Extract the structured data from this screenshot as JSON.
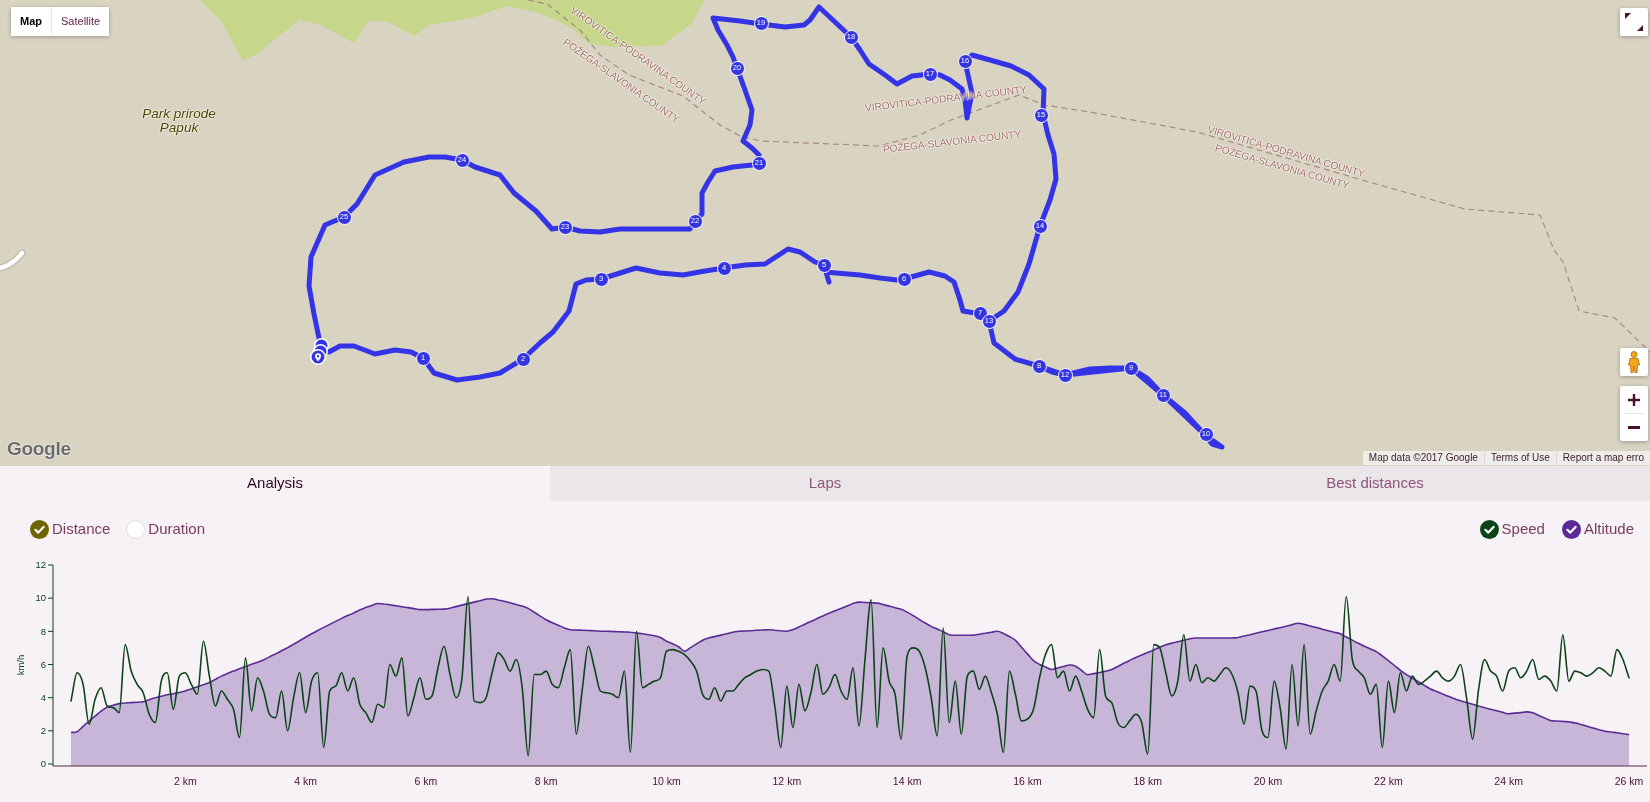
{
  "map": {
    "map_types": [
      {
        "label": "Map",
        "selected": true
      },
      {
        "label": "Satellite",
        "selected": false
      }
    ],
    "labels": [
      {
        "kind": "boundary",
        "text": "VIROVITICA-PODRAVINA COUNTY"
      },
      {
        "kind": "boundary",
        "text": "POŽEGA-SLAVONIA COUNTY"
      },
      {
        "kind": "park",
        "text": "Park prirode Papuk"
      },
      {
        "kind": "boundary",
        "text": "VIROVITICA-PODRAVINA COUNTY"
      },
      {
        "kind": "boundary",
        "text": "POŽEGA-SLAVONIA COUNTY"
      },
      {
        "kind": "boundary",
        "text": "VIROVITICA-PODRAVINA COUNTY"
      },
      {
        "kind": "boundary",
        "text": "POŽEGA-SLAVONIA COUNTY"
      }
    ],
    "markers": [
      "19",
      "18",
      "20",
      "17",
      "16",
      "15",
      "24",
      "21",
      "25",
      "23",
      "22",
      "14",
      "3",
      "4",
      "5",
      "6",
      "7",
      "13",
      "1",
      "2",
      "8",
      "12",
      "9",
      "11",
      "10"
    ],
    "logo": "Google",
    "attribution": [
      "Map data ©2017 Google",
      "Terms of Use",
      "Report a map erro"
    ]
  },
  "tabs": [
    {
      "label": "Analysis",
      "selected": true
    },
    {
      "label": "Laps",
      "selected": false
    },
    {
      "label": "Best distances",
      "selected": false
    }
  ],
  "x_axis_options": [
    {
      "label": "Distance",
      "selected": true
    },
    {
      "label": "Duration",
      "selected": false
    }
  ],
  "series_toggles": [
    {
      "checked": true
    },
    {
      "checked": true
    }
  ],
  "altitude_chart": {
    "chart_data": {
      "type": "area",
      "xlim": [
        -0.2,
        26.3
      ],
      "ylim": [
        0,
        12
      ],
      "x": [
        0.1,
        0.2,
        0.3,
        0.4,
        0.5,
        0.6,
        0.7,
        0.8,
        0.9,
        1,
        1.1,
        1.2,
        1.3,
        1.4,
        1.5,
        1.6,
        1.7,
        1.8,
        1.9,
        2,
        2.1,
        2.2,
        2.3,
        2.4,
        2.5,
        2.6,
        2.7,
        2.8,
        2.9,
        3,
        3.1,
        3.2,
        3.3,
        3.4,
        3.5,
        3.6,
        3.7,
        3.8,
        3.9,
        4,
        4.1,
        4.2,
        4.3,
        4.4,
        4.5,
        4.6,
        4.7,
        4.8,
        4.9,
        5,
        5.1,
        5.2,
        5.3,
        5.4,
        5.5,
        5.6,
        5.7,
        5.8,
        5.9,
        6,
        6.1,
        6.2,
        6.3,
        6.4,
        6.5,
        6.6,
        6.7,
        6.8,
        6.9,
        7,
        7.1,
        7.2,
        7.3,
        7.4,
        7.5,
        7.6,
        7.7,
        7.8,
        7.9,
        8,
        8.1,
        8.2,
        8.3,
        8.4,
        8.5,
        8.6,
        8.7,
        8.8,
        8.9,
        9,
        9.1,
        9.2,
        9.3,
        9.4,
        9.5,
        9.6,
        9.7,
        9.8,
        9.9,
        10,
        10.1,
        10.2,
        10.3,
        10.4,
        10.5,
        10.6,
        10.7,
        10.8,
        10.9,
        11,
        11.1,
        11.2,
        11.3,
        11.4,
        11.5,
        11.6,
        11.7,
        11.8,
        11.9,
        12,
        12.1,
        12.2,
        12.3,
        12.4,
        12.5,
        12.6,
        12.7,
        12.8,
        12.9,
        13,
        13.1,
        13.2,
        13.3,
        13.4,
        13.5,
        13.6,
        13.7,
        13.8,
        13.9,
        14,
        14.1,
        14.2,
        14.3,
        14.4,
        14.5,
        14.6,
        14.7,
        14.8,
        14.9,
        15,
        15.1,
        15.2,
        15.3,
        15.4,
        15.5,
        15.6,
        15.7,
        15.8,
        15.9,
        16,
        16.1,
        16.2,
        16.3,
        16.4,
        16.5,
        16.6,
        16.7,
        16.8,
        16.9,
        17,
        17.1,
        17.2,
        17.3,
        17.4,
        17.5,
        17.6,
        17.7,
        17.8,
        17.9,
        18,
        18.1,
        18.2,
        18.3,
        18.4,
        18.5,
        18.6,
        18.7,
        18.8,
        18.9,
        19,
        19.1,
        19.2,
        19.3,
        19.4,
        19.5,
        19.6,
        19.7,
        19.8,
        19.9,
        20,
        20.1,
        20.2,
        20.3,
        20.4,
        20.5,
        20.6,
        20.7,
        20.8,
        20.9,
        21,
        21.1,
        21.2,
        21.3,
        21.4,
        21.5,
        21.6,
        21.7,
        21.8,
        21.9,
        22,
        22.1,
        22.2,
        22.3,
        22.4,
        22.5,
        22.6,
        22.7,
        22.8,
        22.9,
        23,
        23.1,
        23.2,
        23.3,
        23.4,
        23.5,
        23.6,
        23.7,
        23.8,
        23.9,
        24,
        24.1,
        24.2,
        24.3,
        24.4,
        24.5,
        24.6,
        24.7,
        24.8,
        24.9,
        25,
        25.1,
        25.2,
        25.3,
        25.4,
        25.5,
        25.6,
        25.7,
        25.8,
        25.9,
        26
      ],
      "series": [
        {
          "name": "Altitude",
          "color": "#5b2a96",
          "values": [
            1.9,
            1.95,
            2.27,
            2.58,
            2.88,
            3.19,
            3.43,
            3.54,
            3.64,
            3.68,
            3.7,
            3.72,
            3.75,
            3.88,
            4.0,
            4.09,
            4.17,
            4.24,
            4.31,
            4.4,
            4.53,
            4.66,
            4.78,
            4.91,
            5.1,
            5.3,
            5.45,
            5.6,
            5.74,
            5.88,
            6.01,
            6.14,
            6.27,
            6.46,
            6.64,
            6.83,
            7.01,
            7.22,
            7.43,
            7.64,
            7.85,
            8.05,
            8.24,
            8.42,
            8.6,
            8.78,
            8.95,
            9.11,
            9.28,
            9.43,
            9.55,
            9.68,
            9.65,
            9.6,
            9.54,
            9.48,
            9.43,
            9.37,
            9.31,
            9.31,
            9.32,
            9.33,
            9.34,
            9.39,
            9.49,
            9.58,
            9.67,
            9.76,
            9.85,
            9.95,
            9.97,
            9.89,
            9.81,
            9.72,
            9.62,
            9.52,
            9.38,
            9.15,
            8.92,
            8.7,
            8.52,
            8.37,
            8.21,
            8.1,
            8.08,
            8.07,
            8.05,
            8.03,
            8.01,
            8.0,
            7.99,
            7.98,
            7.96,
            7.95,
            7.9,
            7.85,
            7.79,
            7.73,
            7.62,
            7.4,
            7.25,
            7.07,
            6.8,
            7.02,
            7.24,
            7.46,
            7.6,
            7.68,
            7.77,
            7.85,
            7.94,
            8.0,
            8.02,
            8.04,
            8.06,
            8.08,
            8.1,
            8.07,
            8.04,
            8.01,
            8.1,
            8.26,
            8.43,
            8.6,
            8.76,
            8.93,
            9.09,
            9.24,
            9.38,
            9.53,
            9.67,
            9.76,
            9.74,
            9.72,
            9.7,
            9.61,
            9.52,
            9.42,
            9.33,
            9.16,
            8.94,
            8.72,
            8.5,
            8.3,
            8.14,
            7.97,
            7.8,
            7.76,
            7.76,
            7.76,
            7.77,
            7.83,
            7.89,
            7.95,
            8.01,
            7.87,
            7.69,
            7.46,
            7.05,
            6.64,
            6.23,
            6.0,
            5.85,
            5.7,
            5.79,
            5.88,
            5.97,
            5.89,
            5.64,
            5.38,
            5.45,
            5.52,
            5.59,
            5.7,
            5.88,
            6.07,
            6.25,
            6.43,
            6.58,
            6.73,
            6.88,
            7.04,
            7.19,
            7.29,
            7.37,
            7.46,
            7.55,
            7.6,
            7.6,
            7.6,
            7.6,
            7.6,
            7.6,
            7.6,
            7.63,
            7.72,
            7.8,
            7.88,
            7.97,
            8.05,
            8.14,
            8.22,
            8.31,
            8.4,
            8.49,
            8.42,
            8.32,
            8.23,
            8.13,
            8.04,
            7.95,
            7.86,
            7.66,
            7.47,
            7.28,
            7.1,
            6.94,
            6.78,
            6.52,
            6.23,
            5.94,
            5.65,
            5.39,
            5.17,
            4.96,
            4.74,
            4.52,
            4.37,
            4.22,
            4.08,
            3.93,
            3.81,
            3.71,
            3.6,
            3.49,
            3.39,
            3.3,
            3.21,
            3.12,
            3.03,
            3.07,
            3.1,
            3.14,
            3.09,
            2.93,
            2.78,
            2.62,
            2.59,
            2.57,
            2.54,
            2.48,
            2.38,
            2.28,
            2.17,
            2.07,
            1.98,
            1.93,
            1.88,
            1.82,
            1.77
          ]
        }
      ]
    }
  },
  "speed_chart": {
    "chart_data": {
      "type": "line",
      "ylabel": "km/h",
      "xlim": [
        -0.2,
        26.3
      ],
      "ylim": [
        0,
        12
      ],
      "yticks": [
        0,
        2,
        4,
        6,
        8,
        10,
        12
      ],
      "xticks": [
        {
          "value": 2,
          "label": "2 km"
        },
        {
          "value": 4,
          "label": "4 km"
        },
        {
          "value": 6,
          "label": "6 km"
        },
        {
          "value": 8,
          "label": "8 km"
        },
        {
          "value": 10,
          "label": "10 km"
        },
        {
          "value": 12,
          "label": "12 km"
        },
        {
          "value": 14,
          "label": "14 km"
        },
        {
          "value": 16,
          "label": "16 km"
        },
        {
          "value": 18,
          "label": "18 km"
        },
        {
          "value": 20,
          "label": "20 km"
        },
        {
          "value": 22,
          "label": "22 km"
        },
        {
          "value": 24,
          "label": "24 km"
        },
        {
          "value": 26,
          "label": "26 km"
        }
      ],
      "x": [
        0.1,
        0.2,
        0.3,
        0.4,
        0.5,
        0.6,
        0.7,
        0.8,
        0.9,
        1,
        1.1,
        1.2,
        1.3,
        1.4,
        1.5,
        1.6,
        1.7,
        1.8,
        1.9,
        2,
        2.1,
        2.2,
        2.3,
        2.4,
        2.5,
        2.6,
        2.7,
        2.8,
        2.9,
        3,
        3.1,
        3.2,
        3.3,
        3.4,
        3.5,
        3.6,
        3.7,
        3.8,
        3.9,
        4,
        4.1,
        4.2,
        4.3,
        4.4,
        4.5,
        4.6,
        4.7,
        4.8,
        4.9,
        5,
        5.1,
        5.2,
        5.3,
        5.4,
        5.5,
        5.6,
        5.7,
        5.8,
        5.9,
        6,
        6.1,
        6.2,
        6.3,
        6.4,
        6.5,
        6.6,
        6.7,
        6.8,
        6.9,
        7,
        7.1,
        7.2,
        7.3,
        7.4,
        7.5,
        7.6,
        7.7,
        7.8,
        7.9,
        8,
        8.1,
        8.2,
        8.3,
        8.4,
        8.5,
        8.6,
        8.7,
        8.8,
        8.9,
        9,
        9.1,
        9.2,
        9.3,
        9.4,
        9.5,
        9.6,
        9.7,
        9.8,
        9.9,
        10,
        10.1,
        10.2,
        10.3,
        10.4,
        10.5,
        10.6,
        10.7,
        10.8,
        10.9,
        11,
        11.1,
        11.2,
        11.3,
        11.4,
        11.5,
        11.6,
        11.7,
        11.8,
        11.9,
        12,
        12.1,
        12.2,
        12.3,
        12.4,
        12.5,
        12.6,
        12.7,
        12.8,
        12.9,
        13,
        13.1,
        13.2,
        13.3,
        13.4,
        13.5,
        13.6,
        13.7,
        13.8,
        13.9,
        14,
        14.1,
        14.2,
        14.3,
        14.4,
        14.5,
        14.6,
        14.7,
        14.8,
        14.9,
        15,
        15.1,
        15.2,
        15.3,
        15.4,
        15.5,
        15.6,
        15.7,
        15.8,
        15.9,
        16,
        16.1,
        16.2,
        16.3,
        16.4,
        16.5,
        16.6,
        16.7,
        16.8,
        16.9,
        17,
        17.1,
        17.2,
        17.3,
        17.4,
        17.5,
        17.6,
        17.7,
        17.8,
        17.9,
        18,
        18.1,
        18.2,
        18.3,
        18.4,
        18.5,
        18.6,
        18.7,
        18.8,
        18.9,
        19,
        19.1,
        19.2,
        19.3,
        19.4,
        19.5,
        19.6,
        19.7,
        19.8,
        19.9,
        20,
        20.1,
        20.2,
        20.3,
        20.4,
        20.5,
        20.6,
        20.7,
        20.8,
        20.9,
        21,
        21.1,
        21.2,
        21.3,
        21.4,
        21.5,
        21.6,
        21.7,
        21.8,
        21.9,
        22,
        22.1,
        22.2,
        22.3,
        22.4,
        22.5,
        22.6,
        22.7,
        22.8,
        22.9,
        23,
        23.1,
        23.2,
        23.3,
        23.4,
        23.5,
        23.6,
        23.7,
        23.8,
        23.9,
        24,
        24.1,
        24.2,
        24.3,
        24.4,
        24.5,
        24.6,
        24.7,
        24.8,
        24.9,
        25,
        25.1,
        25.2,
        25.3,
        25.4,
        25.5,
        25.6,
        25.7,
        25.8,
        25.9,
        26
      ],
      "series": [
        {
          "name": "Speed",
          "color": "#0d4318",
          "values": [
            3.8,
            5.5,
            4.8,
            2.4,
            3.9,
            4.6,
            3.5,
            3.4,
            3.1,
            7.2,
            5.6,
            4.8,
            4.3,
            3.0,
            2.5,
            5.0,
            5.5,
            3.3,
            5.3,
            5.5,
            4.8,
            4.2,
            7.4,
            5.3,
            3.5,
            4.4,
            3.9,
            3.3,
            1.6,
            6.4,
            3.2,
            5.2,
            4.4,
            3.0,
            2.8,
            4.4,
            2.0,
            4.0,
            5.5,
            3.1,
            5.0,
            5.5,
            1.0,
            4.4,
            4.7,
            5.5,
            4.4,
            5.2,
            3.6,
            3.1,
            2.5,
            3.6,
            3.4,
            6.0,
            5.3,
            6.4,
            2.9,
            4.0,
            5.2,
            3.9,
            4.1,
            5.8,
            7.1,
            5.4,
            4.0,
            5.2,
            10.1,
            3.8,
            3.7,
            4.0,
            5.5,
            6.7,
            6.3,
            5.6,
            6.3,
            4.6,
            0.5,
            5.4,
            5.4,
            5.6,
            4.8,
            4.6,
            5.8,
            6.9,
            1.8,
            4.5,
            7.1,
            5.8,
            4.4,
            4.3,
            4.2,
            4.0,
            5.6,
            0.7,
            8.0,
            4.6,
            4.8,
            5.0,
            5.2,
            6.8,
            6.9,
            6.8,
            6.6,
            6.2,
            5.6,
            4.2,
            3.9,
            4.6,
            3.8,
            4.4,
            4.4,
            4.8,
            5.2,
            5.4,
            5.6,
            5.7,
            5.6,
            3.5,
            1.0,
            4.7,
            2.2,
            4.8,
            3.2,
            4.3,
            6.0,
            4.2,
            4.6,
            5.4,
            4.4,
            3.9,
            5.8,
            2.3,
            6.3,
            9.9,
            2.2,
            7.0,
            5.0,
            4.2,
            1.5,
            6.5,
            7.0,
            6.8,
            5.8,
            4.0,
            1.7,
            8.2,
            2.5,
            5.0,
            1.8,
            5.3,
            5.6,
            4.5,
            5.3,
            4.3,
            3.0,
            0.7,
            5.6,
            4.2,
            2.6,
            2.7,
            3.3,
            5.2,
            6.6,
            7.2,
            5.2,
            5.6,
            4.4,
            5.3,
            4.4,
            3.3,
            2.8,
            6.9,
            4.1,
            3.7,
            2.5,
            2.2,
            2.6,
            3.0,
            2.5,
            0.6,
            7.2,
            7.0,
            5.5,
            4.1,
            5.0,
            7.8,
            5.0,
            6.0,
            4.9,
            5.2,
            5.0,
            5.4,
            5.8,
            5.4,
            4.3,
            2.4,
            4.7,
            4.4,
            2.0,
            1.6,
            5.0,
            3.4,
            0.9,
            6.0,
            2.3,
            7.2,
            1.8,
            3.2,
            4.4,
            5.0,
            6.0,
            5.0,
            10.1,
            6.3,
            5.6,
            5.2,
            4.2,
            4.8,
            1.0,
            5.0,
            3.1,
            5.5,
            4.4,
            5.3,
            4.8,
            5.0,
            5.3,
            5.6,
            5.2,
            5.0,
            5.3,
            6.0,
            4.0,
            1.5,
            4.5,
            6.3,
            5.6,
            5.3,
            4.4,
            5.6,
            5.8,
            5.2,
            5.6,
            6.3,
            5.1,
            5.3,
            5.0,
            4.4,
            7.8,
            5.0,
            5.6,
            5.5,
            5.3,
            5.5,
            5.8,
            5.6,
            5.3,
            6.9,
            6.3,
            5.2
          ]
        }
      ]
    }
  }
}
